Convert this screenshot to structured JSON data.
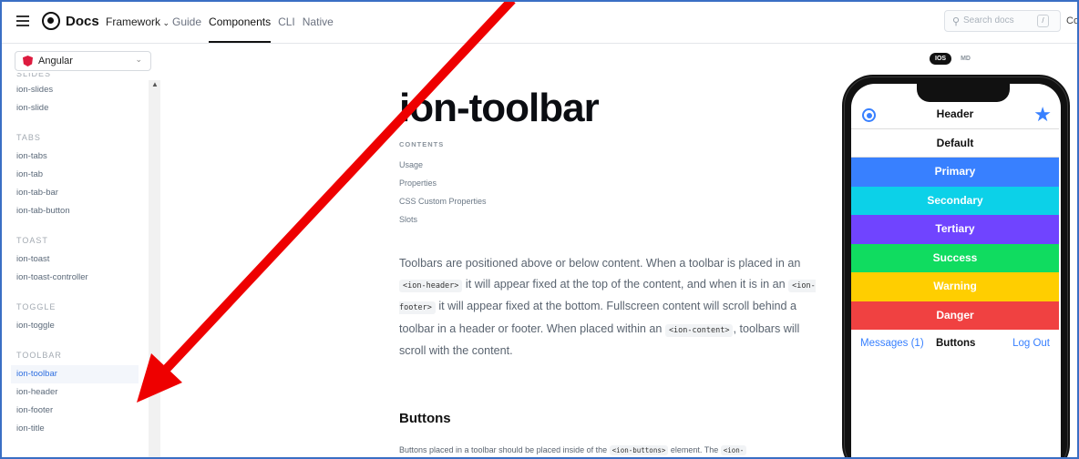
{
  "topbar": {
    "brand": "Docs",
    "framework_label": "Framework",
    "nav": [
      "Guide",
      "Components",
      "CLI",
      "Native"
    ],
    "active_nav": "Components",
    "search_placeholder": "Search docs",
    "search_shortcut": "/",
    "cut_text": "Co"
  },
  "sidebar": {
    "framework_select": "Angular",
    "sections": [
      {
        "title": "SLIDES",
        "items": [
          "ion-slides",
          "ion-slide"
        ]
      },
      {
        "title": "TABS",
        "items": [
          "ion-tabs",
          "ion-tab",
          "ion-tab-bar",
          "ion-tab-button"
        ]
      },
      {
        "title": "TOAST",
        "items": [
          "ion-toast",
          "ion-toast-controller"
        ]
      },
      {
        "title": "TOGGLE",
        "items": [
          "ion-toggle"
        ]
      },
      {
        "title": "TOOLBAR",
        "items": [
          "ion-toolbar",
          "ion-header",
          "ion-footer",
          "ion-title"
        ]
      }
    ],
    "active_item": "ion-toolbar"
  },
  "main": {
    "title": "ion-toolbar",
    "contents_title": "CONTENTS",
    "toc": [
      "Usage",
      "Properties",
      "CSS Custom Properties",
      "Slots"
    ],
    "paragraph": {
      "p1": "Toolbars are positioned above or below content. When a toolbar is placed in an ",
      "c1": "<ion-header>",
      "p2": " it will appear fixed at the top of the content, and when it is in an ",
      "c2": "<ion-footer>",
      "p3": " it will appear fixed at the bottom. Fullscreen content will scroll behind a toolbar in a header or footer. When placed within an ",
      "c3": "<ion-content>",
      "p4": ", toolbars will scroll with the content."
    },
    "buttons_heading": "Buttons",
    "buttons_para": {
      "p1": "Buttons placed in a toolbar should be placed inside of the ",
      "c1": "<ion-buttons>",
      "p2": " element. The ",
      "c2": "<ion-"
    }
  },
  "preview": {
    "modes": [
      "IOS",
      "MD"
    ],
    "active_mode": "IOS",
    "header_title": "Header",
    "default_title": "Default",
    "colored": [
      {
        "label": "Primary",
        "color": "#3880ff"
      },
      {
        "label": "Secondary",
        "color": "#0cd1e8"
      },
      {
        "label": "Tertiary",
        "color": "#7044ff"
      },
      {
        "label": "Success",
        "color": "#10dc60"
      },
      {
        "label": "Warning",
        "color": "#ffce00"
      },
      {
        "label": "Danger",
        "color": "#f04141"
      }
    ],
    "footer": {
      "left": "Messages (1)",
      "middle": "Buttons",
      "right": "Log Out"
    }
  }
}
